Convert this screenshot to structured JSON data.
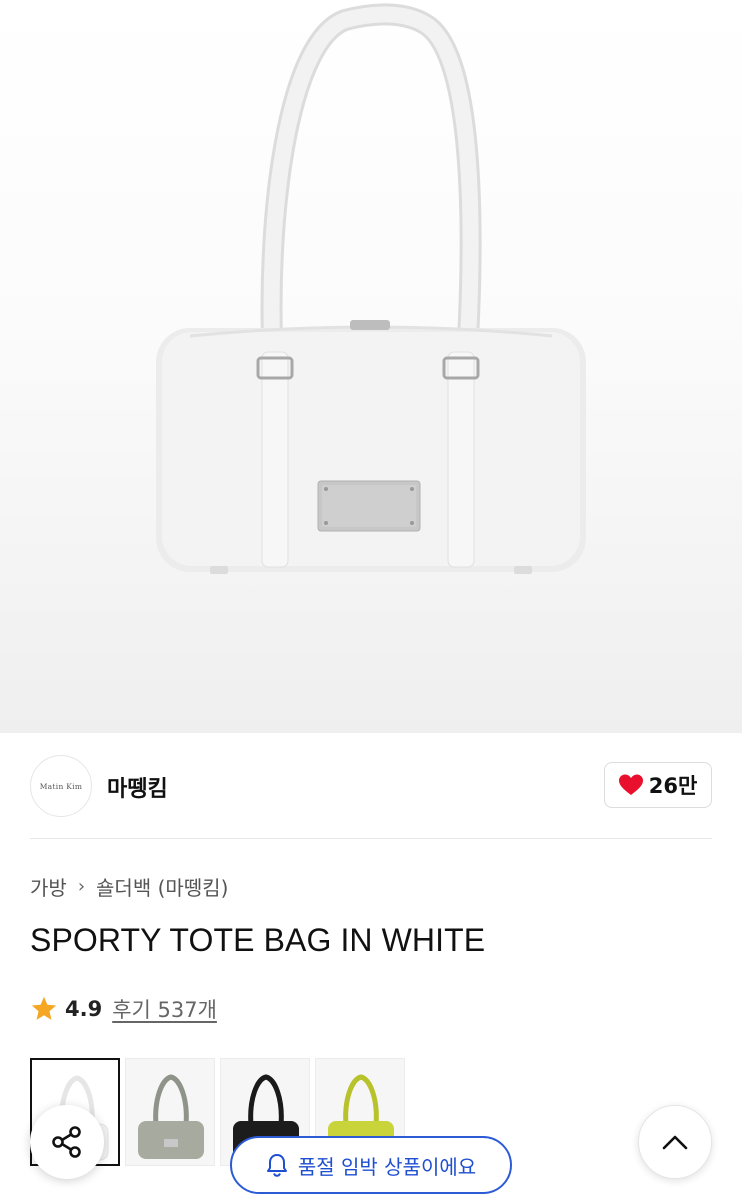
{
  "product": {
    "image_alt": "White sporty tote bag",
    "title": "SPORTY TOTE BAG IN WHITE"
  },
  "brand": {
    "logo_text": "Matin  Kim",
    "name": "마뗑킴",
    "likes": "26만"
  },
  "breadcrumb": {
    "category": "가방",
    "subcategory": "숄더백 (마뗑킴)"
  },
  "rating": {
    "score": "4.9",
    "reviews_label": "후기 537개"
  },
  "color_options": [
    {
      "color": "white",
      "selected": true
    },
    {
      "color": "gray",
      "selected": false
    },
    {
      "color": "black",
      "selected": false
    },
    {
      "color": "lime",
      "selected": false
    }
  ],
  "notice": {
    "label": "품절 임박 상품이에요",
    "accent": "#1f4fd1"
  },
  "colors": {
    "heart": "#e8102c",
    "star": "#f5a623"
  },
  "icons": {
    "share": "share-icon",
    "scroll_top": "chevron-up-icon",
    "bell": "bell-icon"
  }
}
